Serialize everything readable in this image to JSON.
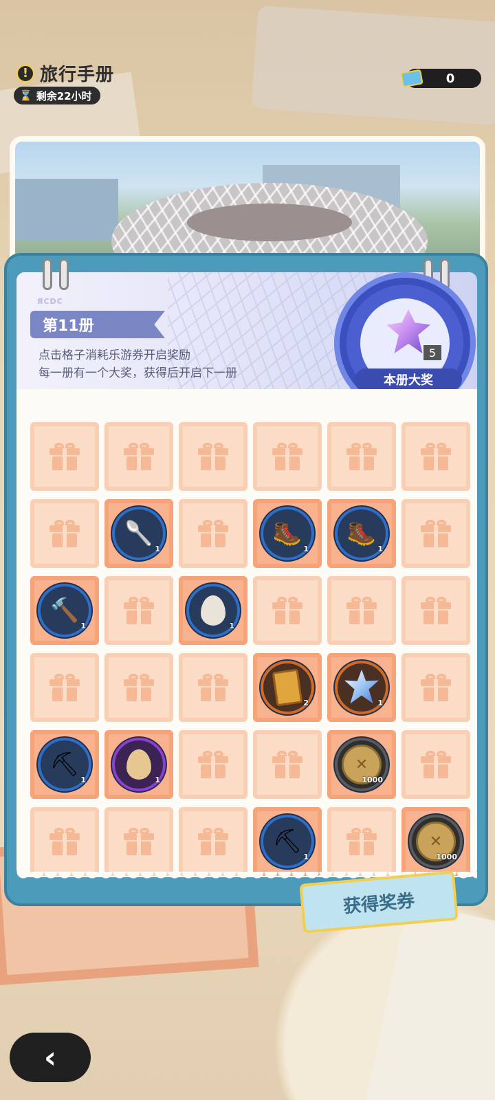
{
  "header": {
    "title": "旅行手册",
    "timer": "剩余22小时",
    "ticket_count": "0"
  },
  "volume": {
    "label": "第11册",
    "desc_line1": "点击格子消耗乐游券开启奖励",
    "desc_line2": "每一册有一个大奖，获得后开启下一册",
    "grand_prize_label": "本册大奖",
    "grand_prize_count": "5"
  },
  "grid": [
    [
      "gift",
      "gift",
      "gift",
      "gift",
      "gift",
      "gift"
    ],
    [
      {
        "slot": "gift"
      }
    ]
  ],
  "cells": [
    {
      "t": "gift"
    },
    {
      "t": "gift"
    },
    {
      "t": "gift"
    },
    {
      "t": "gift"
    },
    {
      "t": "gift"
    },
    {
      "t": "gift"
    },
    {
      "t": "gift"
    },
    {
      "t": "item",
      "icon": "shovel",
      "rarity": "blue",
      "qty": "1"
    },
    {
      "t": "gift"
    },
    {
      "t": "item",
      "icon": "boots",
      "rarity": "blue",
      "qty": "1"
    },
    {
      "t": "item",
      "icon": "boots",
      "rarity": "blue",
      "qty": "1"
    },
    {
      "t": "gift"
    },
    {
      "t": "item",
      "icon": "hammer",
      "rarity": "blue",
      "qty": "1"
    },
    {
      "t": "gift"
    },
    {
      "t": "item",
      "icon": "egg",
      "rarity": "blue",
      "qty": "1"
    },
    {
      "t": "gift"
    },
    {
      "t": "gift"
    },
    {
      "t": "gift"
    },
    {
      "t": "gift"
    },
    {
      "t": "gift"
    },
    {
      "t": "gift"
    },
    {
      "t": "item",
      "icon": "card",
      "rarity": "bronze",
      "qty": "2"
    },
    {
      "t": "item",
      "icon": "star",
      "rarity": "bronze",
      "qty": "1"
    },
    {
      "t": "gift"
    },
    {
      "t": "item",
      "icon": "pickaxe",
      "rarity": "blue",
      "qty": "1"
    },
    {
      "t": "item",
      "icon": "golden-egg",
      "rarity": "purple",
      "qty": "1"
    },
    {
      "t": "gift"
    },
    {
      "t": "gift"
    },
    {
      "t": "item",
      "icon": "coin",
      "rarity": "gray",
      "qty": "1000"
    },
    {
      "t": "gift"
    },
    {
      "t": "gift"
    },
    {
      "t": "gift"
    },
    {
      "t": "gift"
    },
    {
      "t": "item",
      "icon": "pickaxe",
      "rarity": "blue",
      "qty": "1"
    },
    {
      "t": "gift"
    },
    {
      "t": "item",
      "icon": "coin",
      "rarity": "gray",
      "qty": "1000"
    }
  ],
  "buttons": {
    "claim_label": "获得奖券",
    "back_label": "‹"
  },
  "colors": {
    "board_blue": "#4c9bbb",
    "cell_peach": "#fbdcc6",
    "opened_cell": "#f8b38e"
  }
}
